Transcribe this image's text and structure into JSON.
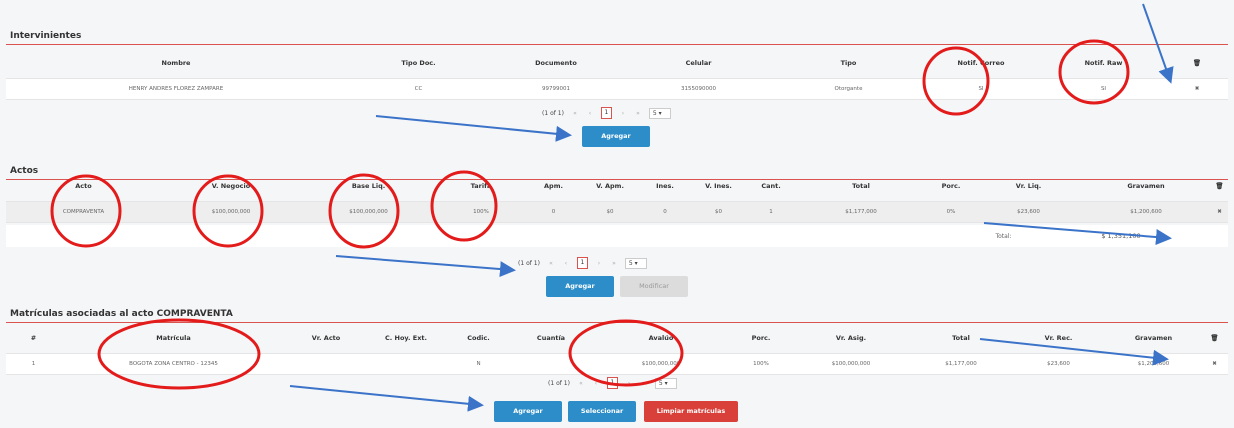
{
  "intervinientes": {
    "title": "Intervinientes",
    "headers": [
      "Nombre",
      "Tipo Doc.",
      "Documento",
      "Celular",
      "Tipo",
      "Notif. Correo",
      "Notif. Raw"
    ],
    "row": [
      "HENRY ANDRES FLOREZ ZAMPARE",
      "CC",
      "99799001",
      "3155090000",
      "Otorgante",
      "SI",
      "SI"
    ],
    "pager": {
      "info": "(1 of 1)",
      "first": "«",
      "prev": "‹",
      "page": "1",
      "next": "›",
      "last": "»",
      "size": "5"
    },
    "add_label": "Agregar"
  },
  "actos": {
    "title": "Actos",
    "headers": [
      "Acto",
      "V. Negocio",
      "Base Liq.",
      "Tarifa",
      "Apm.",
      "V. Apm.",
      "Ines.",
      "V. Ines.",
      "Cant.",
      "Total",
      "Porc.",
      "Vr. Liq.",
      "Gravamen"
    ],
    "row": [
      "COMPRAVENTA",
      "$100,000,000",
      "$100,000,000",
      "100%",
      "0",
      "$0",
      "0",
      "$0",
      "1",
      "$1,177,000",
      "0%",
      "$23,600",
      "$1,200,600"
    ],
    "total_label": "Total:",
    "total_value": "$ 1,351,100",
    "pager": {
      "info": "(1 of 1)",
      "first": "«",
      "prev": "‹",
      "page": "1",
      "next": "›",
      "last": "»",
      "size": "5"
    },
    "add_label": "Agregar",
    "modify_label": "Modificar"
  },
  "matriculas": {
    "title": "Matrículas asociadas al acto COMPRAVENTA",
    "headers": [
      "#",
      "Matrícula",
      "Vr. Acto",
      "C. Hoy. Ext.",
      "Codic.",
      "Cuantía",
      "Avalúo",
      "Porc.",
      "Vr. Asig.",
      "Total",
      "Vr. Rec.",
      "Gravamen"
    ],
    "row": [
      "1",
      "BOGOTA ZONA CENTRO - 12345",
      "",
      "",
      "N",
      "",
      "$100,000,000",
      "100%",
      "$100,000,000",
      "$1,177,000",
      "$23,600",
      "$1,200,600"
    ],
    "pager": {
      "info": "(1 of 1)",
      "first": "«",
      "prev": "‹",
      "page": "1",
      "next": "›",
      "last": "»",
      "size": "5"
    },
    "add_label": "Agregar",
    "select_label": "Seleccionar",
    "clear_label": "Limpiar matrículas"
  },
  "icons": {
    "trash": "trash-icon",
    "delete": "delete-x-icon"
  },
  "colors": {
    "accent": "#d9534f",
    "primary": "#2c8dc8",
    "annotation_ellipse": "#e31b1b",
    "annotation_arrow": "#3b73c9"
  }
}
